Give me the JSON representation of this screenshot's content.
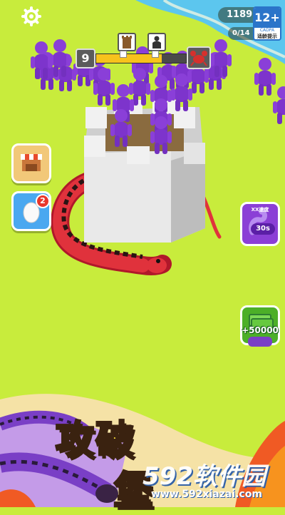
{
  "hud": {
    "coins": "1189",
    "capacity": "0/14",
    "level": "9",
    "progress_fraction": 0.73,
    "settings_icon": "gear-icon",
    "start_icon": "tower-icon",
    "mid_icon": "person-icon",
    "boss_icon": "crab-icon"
  },
  "age_rating": {
    "rating": "12+",
    "org": "CADPA",
    "note": "适龄提示"
  },
  "left_buttons": [
    {
      "icon": "shop-icon"
    },
    {
      "icon": "egg-icon",
      "badge": "2"
    }
  ],
  "right_buttons": {
    "speed_label": "XX速度",
    "speed_timer": "30s",
    "speed_icon": "snake-speed-icon",
    "cash_icon": "cash-stack-icon",
    "cash_label": "+50000"
  },
  "banner": {
    "title_line1": "攻破",
    "title_line2_partial": "堡"
  },
  "watermark": {
    "title": "592软件园",
    "url": "www.592xiazai.com"
  },
  "colors": {
    "grass": "#c8ec3c",
    "water": "#5cc6ee",
    "enemy": "#8a3fd8",
    "snake": "#e0323c",
    "banner_text": "#ffe437"
  }
}
